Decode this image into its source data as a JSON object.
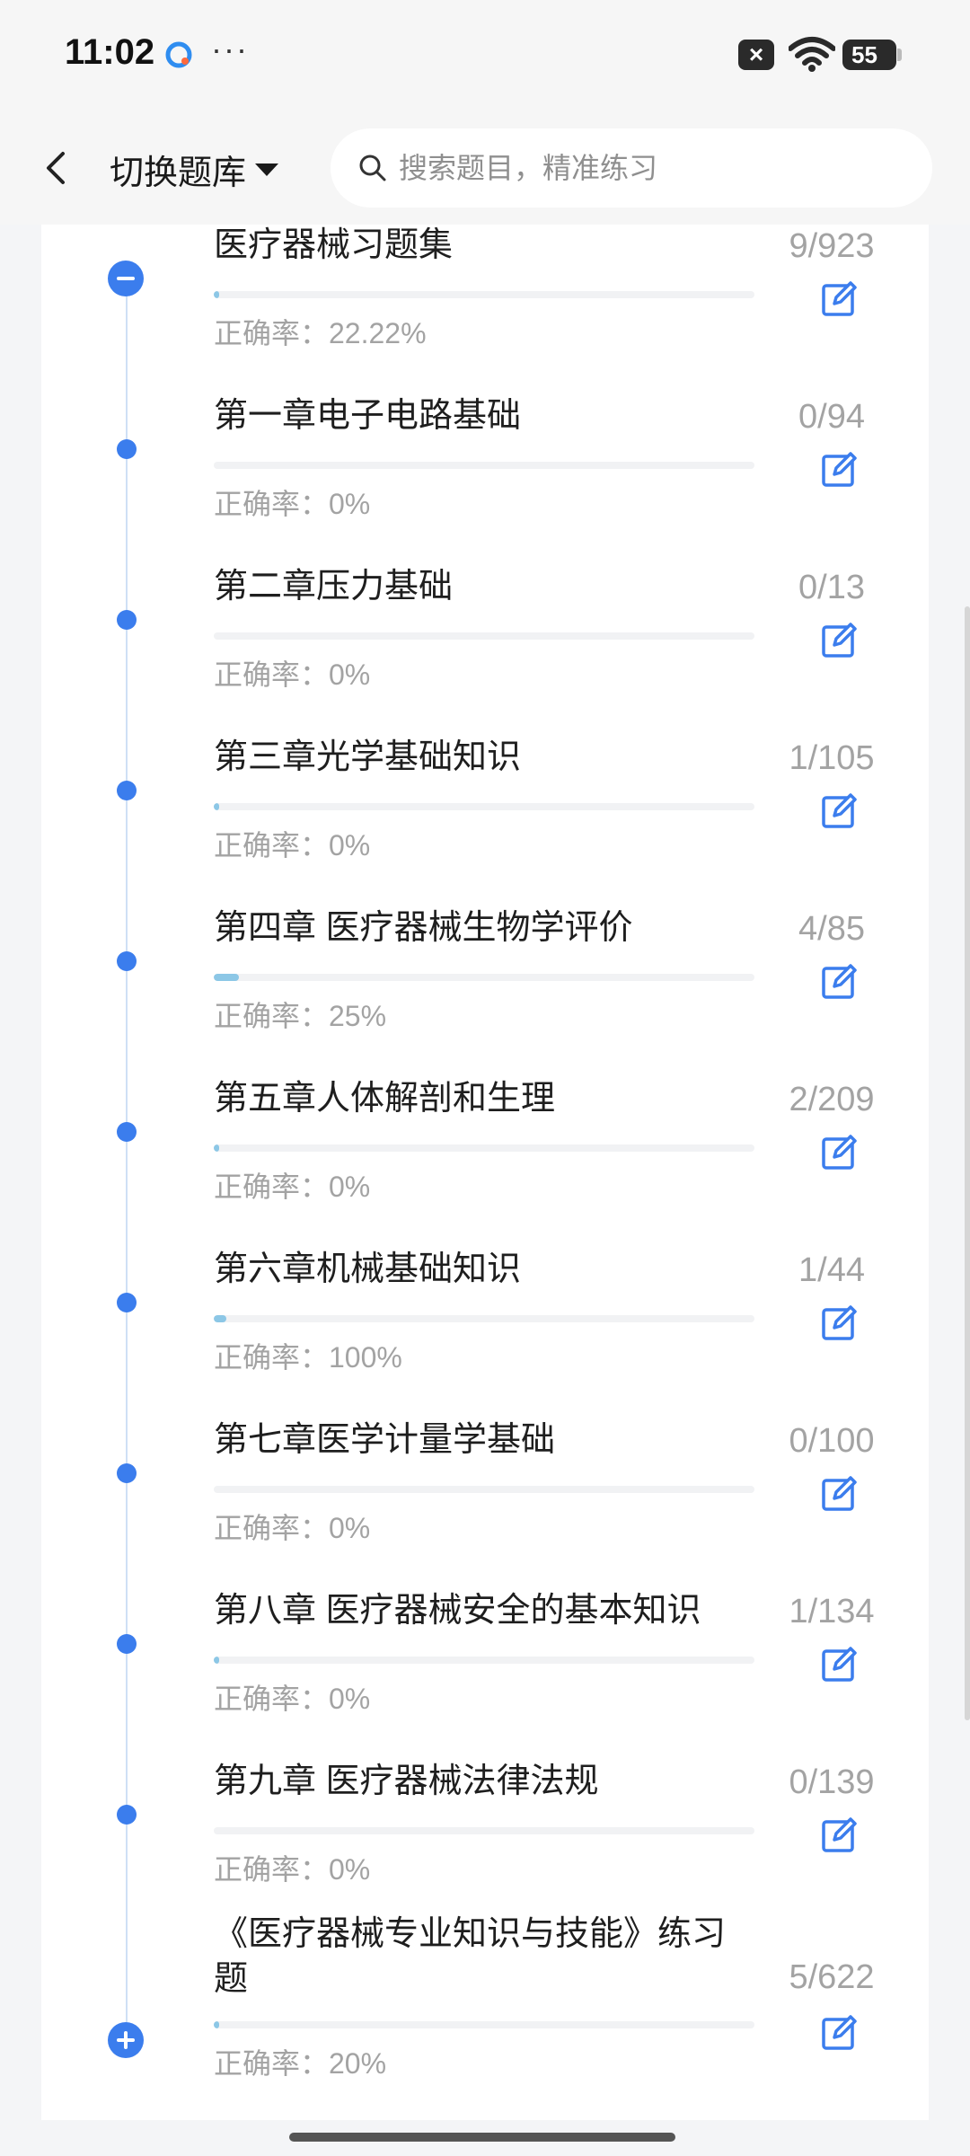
{
  "status_bar": {
    "time": "11:02",
    "dots": "···",
    "battery": "55"
  },
  "header": {
    "switch_label": "切换题库",
    "search_placeholder": "搜索题目，精准练习"
  },
  "items": [
    {
      "title": "医疗器械习题集",
      "count": "9/923",
      "rate": "正确率：22.22%",
      "progress": 0.0098,
      "node": "minus"
    },
    {
      "title": "第一章电子电路基础",
      "count": "0/94",
      "rate": "正确率：0%",
      "progress": 0,
      "node": "dot"
    },
    {
      "title": "第二章压力基础",
      "count": "0/13",
      "rate": "正确率：0%",
      "progress": 0,
      "node": "dot"
    },
    {
      "title": "第三章光学基础知识",
      "count": "1/105",
      "rate": "正确率：0%",
      "progress": 0.0095,
      "node": "dot"
    },
    {
      "title": "第四章 医疗器械生物学评价",
      "count": "4/85",
      "rate": "正确率：25%",
      "progress": 0.047,
      "node": "dot"
    },
    {
      "title": "第五章人体解剖和生理",
      "count": "2/209",
      "rate": "正确率：0%",
      "progress": 0.0096,
      "node": "dot"
    },
    {
      "title": "第六章机械基础知识",
      "count": "1/44",
      "rate": "正确率：100%",
      "progress": 0.023,
      "node": "dot"
    },
    {
      "title": "第七章医学计量学基础",
      "count": "0/100",
      "rate": "正确率：0%",
      "progress": 0,
      "node": "dot"
    },
    {
      "title": "第八章 医疗器械安全的基本知识",
      "count": "1/134",
      "rate": "正确率：0%",
      "progress": 0.0075,
      "node": "dot"
    },
    {
      "title": "第九章 医疗器械法律法规",
      "count": "0/139",
      "rate": "正确率：0%",
      "progress": 0,
      "node": "dot"
    },
    {
      "title": "《医疗器械专业知识与技能》练习题",
      "count": "5/622",
      "rate": "正确率：20%",
      "progress": 0.008,
      "node": "plus"
    }
  ],
  "colors": {
    "accent": "#3b7ded",
    "progress": "#8cc7e6"
  }
}
